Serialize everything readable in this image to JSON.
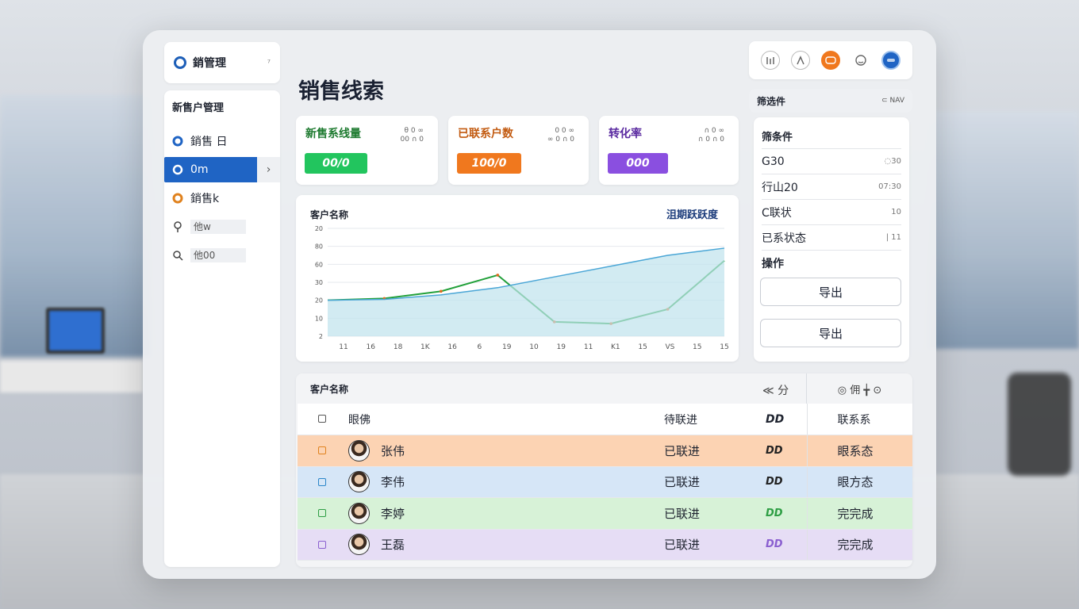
{
  "brand": {
    "title": "銷管理",
    "chevron": "⁷"
  },
  "page_title": "销售线索",
  "sidebar": {
    "section": "新售户管理",
    "items": [
      {
        "label": "銷售 日",
        "icon": "circle-icon"
      },
      {
        "label": "0m",
        "icon": "circle-outline-icon",
        "active": true,
        "arrow": "›"
      },
      {
        "label": "銷售k",
        "icon": "circle-half-icon"
      },
      {
        "label": "他w",
        "icon": "location-icon"
      },
      {
        "label": "他00",
        "icon": "search-icon"
      }
    ]
  },
  "stats": [
    {
      "label": "新售系线量",
      "mini": "θ 0 ∞\n00 ∩ 0",
      "value": "00/0",
      "color": "#22c55e",
      "label_color": "#1d7a2f"
    },
    {
      "label": "已联系户数",
      "mini": "0 0 ∞\n∞ 0 ∩ 0",
      "value": "100/0",
      "color": "#f0781e",
      "label_color": "#c25a10"
    },
    {
      "label": "转化率",
      "mini": "∩ 0 ∞\n∩ 0 ∩ 0",
      "value": "000",
      "color": "#8a4fe0",
      "label_color": "#5a2aa0"
    }
  ],
  "chart_data": {
    "type": "line",
    "title": "客户名称",
    "legend": "沮期跃跃度",
    "y_ticks": [
      "2",
      "10",
      "20",
      "30",
      "60",
      "80",
      "20"
    ],
    "x_ticks": [
      "11",
      "16",
      "18",
      "1K",
      "16",
      "6",
      "19",
      "10",
      "19",
      "11",
      "K1",
      "15",
      "VS",
      "15",
      "15"
    ],
    "series": [
      {
        "color": "#22a03a",
        "values": [
          20,
          21,
          25,
          34,
          8,
          7,
          15,
          42
        ]
      },
      {
        "color": "#4aa6d6",
        "values": [
          20,
          20.5,
          23,
          27,
          33,
          39,
          45,
          49
        ]
      }
    ],
    "ylim": [
      0,
      60
    ],
    "grid": true
  },
  "toolbar_icons": [
    "chart-icon",
    "bars-icon",
    "chat-icon",
    "emoji-icon",
    "user-icon"
  ],
  "filter": {
    "head_label": "筛选件",
    "head_right": "⊂ NAV",
    "section": "筛条件",
    "rows": [
      {
        "label": "G30",
        "value": "◌30"
      },
      {
        "label": "行山20",
        "value": "07:30"
      },
      {
        "label": "C联状",
        "value": "10"
      },
      {
        "label": "已系状态",
        "value": "|  11"
      }
    ],
    "ops_label": "操作",
    "btn1": "导出",
    "btn2": "导出"
  },
  "table": {
    "toolbar_title": "客户名称",
    "toolbar_mid": "≪ 分",
    "toolbar_right": "◎ 佣 ╈ ⊙",
    "header": {
      "name": "眼佛",
      "status": "待联进",
      "code": "DD",
      "contact": "联系系"
    },
    "rows": [
      {
        "name": "张伟",
        "status": "已联进",
        "code": "DD",
        "contact": "眼系态",
        "bg": "#fcd3b3",
        "cb": "#e0821e",
        "code_color": "#222"
      },
      {
        "name": "李伟",
        "status": "已联进",
        "code": "DD",
        "contact": "眼方态",
        "bg": "#d6e6f7",
        "cb": "#2b86c9",
        "code_color": "#222"
      },
      {
        "name": "李婷",
        "status": "已联进",
        "code": "DD",
        "contact": "完完成",
        "bg": "#d7f2d7",
        "cb": "#2e9e44",
        "code_color": "#2e9e44"
      },
      {
        "name": "王磊",
        "status": "已联进",
        "code": "DD",
        "contact": "完完成",
        "bg": "#e6ddf5",
        "cb": "#8a5fd0",
        "code_color": "#8a5fd0"
      }
    ]
  }
}
